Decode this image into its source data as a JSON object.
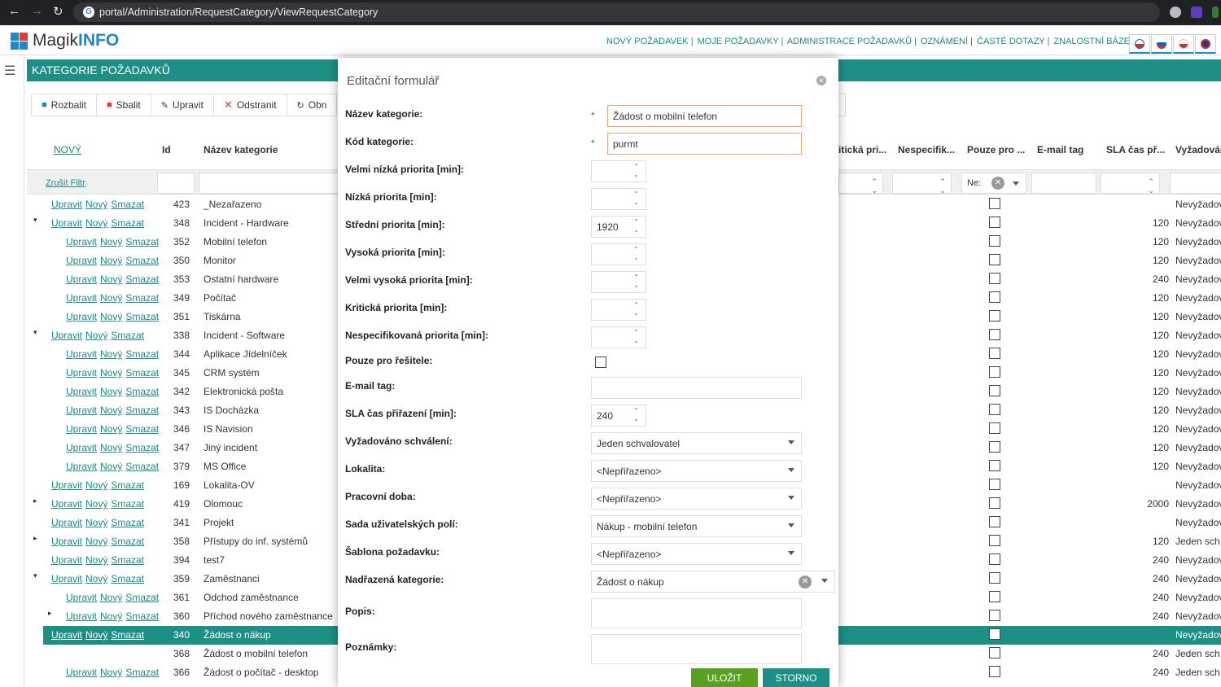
{
  "browser": {
    "url": "portal/Administration/RequestCategory/ViewRequestCategory"
  },
  "app": {
    "logo_plain": "Magik",
    "logo_bold": "INFO"
  },
  "topnav": [
    "NOVÝ POŽADAVEK |",
    "MOJE POŽADAVKY |",
    "ADMINISTRACE POŽADAVKŮ |",
    "OZNÁMENÍ |",
    "ČASTÉ DOTAZY |",
    "ZNALOSTNÍ BÁZE"
  ],
  "page_title": "KATEGORIE POŽADAVKŮ",
  "toolbar": {
    "expand": "Rozbalit",
    "collapse": "Sbalit",
    "edit": "Upravit",
    "delete": "Odstranit",
    "refresh": "Obn"
  },
  "grid": {
    "headers": {
      "new": "NOVÝ",
      "id": "Id",
      "name": "Název kategorie",
      "critical": "itická pri...",
      "unspecified": "Nespecifik...",
      "solvers_only": "Pouze pro ...",
      "email_tag": "E-mail tag",
      "sla": "SLA čas př...",
      "approval": "Vyžadován"
    },
    "filter": {
      "clear": "Zrušit Filtr",
      "solvers_value": "Ne:"
    },
    "actions": [
      "Upravit",
      "Nový",
      "Smazat"
    ],
    "rows": [
      {
        "id": "423",
        "name": "_Nezařazeno",
        "sla": "",
        "approval": "Nevyžadov"
      },
      {
        "id": "348",
        "name": "Incident - Hardware",
        "sla": "120",
        "approval": "Nevyžadov"
      },
      {
        "id": "352",
        "name": "Mobilní telefon",
        "sla": "120",
        "approval": "Nevyžadov"
      },
      {
        "id": "350",
        "name": "Monitor",
        "sla": "120",
        "approval": "Nevyžadov"
      },
      {
        "id": "353",
        "name": "Ostatní hardware",
        "sla": "240",
        "approval": "Nevyžadov"
      },
      {
        "id": "349",
        "name": "Počítač",
        "sla": "120",
        "approval": "Nevyžadov"
      },
      {
        "id": "351",
        "name": "Tiskárna",
        "sla": "120",
        "approval": "Nevyžadov"
      },
      {
        "id": "338",
        "name": "Incident - Software",
        "sla": "120",
        "approval": "Nevyžadov"
      },
      {
        "id": "344",
        "name": "Aplikace Jídelníček",
        "sla": "120",
        "approval": "Nevyžadov"
      },
      {
        "id": "345",
        "name": "CRM systém",
        "sla": "120",
        "approval": "Nevyžadov"
      },
      {
        "id": "342",
        "name": "Elektronická pošta",
        "sla": "120",
        "approval": "Nevyžadov"
      },
      {
        "id": "343",
        "name": "IS Docházka",
        "sla": "120",
        "approval": "Nevyžadov"
      },
      {
        "id": "346",
        "name": "IS Navision",
        "sla": "120",
        "approval": "Nevyžadov"
      },
      {
        "id": "347",
        "name": "Jiný incident",
        "sla": "120",
        "approval": "Nevyžadov"
      },
      {
        "id": "379",
        "name": "MS Office",
        "sla": "120",
        "approval": "Nevyžadov"
      },
      {
        "id": "169",
        "name": "Lokalita-OV",
        "sla": "",
        "approval": "Nevyžadov"
      },
      {
        "id": "419",
        "name": "Olomouc",
        "sla": "2000",
        "approval": "Nevyžadov"
      },
      {
        "id": "341",
        "name": "Projekt",
        "sla": "",
        "approval": "Nevyžadov"
      },
      {
        "id": "358",
        "name": "Přístupy do inf. systémů",
        "sla": "120",
        "approval": "Jeden sch"
      },
      {
        "id": "394",
        "name": "test7",
        "sla": "240",
        "approval": "Nevyžadov"
      },
      {
        "id": "359",
        "name": "Zaměstnanci",
        "sla": "240",
        "approval": "Nevyžadov"
      },
      {
        "id": "361",
        "name": "Odchod zaměstnance",
        "sla": "240",
        "approval": "Nevyžadov"
      },
      {
        "id": "360",
        "name": "Příchod nového zaměstnance",
        "sla": "240",
        "approval": "Nevyžadov"
      },
      {
        "id": "340",
        "name": "Žádost o nákup",
        "sla": "",
        "approval": "Nevyžadov"
      },
      {
        "id": "368",
        "name": "Žádost o mobilní telefon",
        "sla": "240",
        "approval": "Jeden sch"
      },
      {
        "id": "366",
        "name": "Žádost o počítač - desktop",
        "sla": "240",
        "approval": "Jeden sch"
      }
    ]
  },
  "modal": {
    "title": "Editační formulář",
    "required_mark": "*",
    "labels": {
      "name": "Název kategorie:",
      "code": "Kód kategorie:",
      "very_low": "Velmi nízká priorita [min]:",
      "low": "Nízká priorita [min]:",
      "medium": "Střední priorita [min]:",
      "high": "Vysoká priorita [min]:",
      "very_high": "Velmi vysoká priorita [min]:",
      "critical": "Kritická priorita [min]:",
      "unspecified": "Nespecifikovaná priorita [min]:",
      "solvers_only": "Pouze pro řešitele:",
      "email_tag": "E-mail tag:",
      "sla": "SLA čas přiřazení [min]:",
      "approval": "Vyžadováno schválení:",
      "locality": "Lokalita:",
      "work_time": "Pracovní doba:",
      "user_fields": "Sada uživatelských polí:",
      "template": "Šablona požadavku:",
      "parent": "Nadřazená kategorie:",
      "description": "Popis:",
      "notes": "Poznámky:"
    },
    "values": {
      "name": "Žádost o mobilní telefon",
      "code": "purmt",
      "medium": "1920",
      "sla": "240",
      "approval": "Jeden schvalovatel",
      "locality": "<Nepřiřazeno>",
      "work_time": "<Nepřiřazeno>",
      "user_fields": "Nákup - mobilní telefon",
      "template": "<Nepřiřazeno>",
      "parent": "Žádost o nákup"
    },
    "save": "ULOŽIT",
    "cancel": "STORNO"
  }
}
